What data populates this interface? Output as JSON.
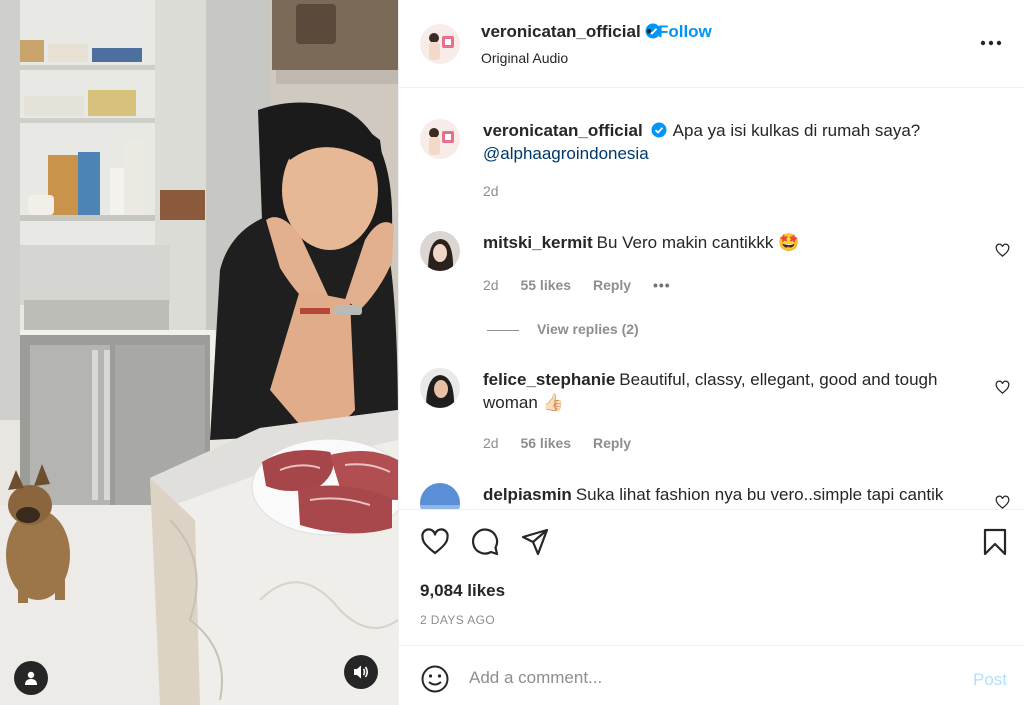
{
  "post": {
    "author": "veronicatan_official",
    "follow_label": "Follow",
    "separator": "•",
    "audio_label": "Original Audio",
    "more_icon": "more-horizontal-icon",
    "caption": {
      "username": "veronicatan_official",
      "text": "Apa ya isi kulkas di rumah saya?",
      "mention": "@alphaagroindonesia",
      "time": "2d"
    }
  },
  "comments": [
    {
      "username": "mitski_kermit",
      "text": "Bu Vero makin cantikkk 🤩",
      "time": "2d",
      "likes": "55 likes",
      "reply_label": "Reply",
      "more": "•••",
      "view_replies": "View replies (2)"
    },
    {
      "username": "felice_stephanie",
      "text": "Beautiful, classy, ellegant, good and tough woman 👍🏻",
      "time": "2d",
      "likes": "56 likes",
      "reply_label": "Reply"
    },
    {
      "username": "delpiasmin",
      "text": "Suka lihat fashion nya bu vero..simple tapi cantik"
    }
  ],
  "actions": {
    "likes": "9,084 likes",
    "date": "2 DAYS AGO"
  },
  "composer": {
    "placeholder": "Add a comment...",
    "post_label": "Post"
  },
  "colors": {
    "accent": "#0095f6",
    "post_disabled": "#b2dffc",
    "muted": "#8e8e8e",
    "text": "#262626"
  }
}
